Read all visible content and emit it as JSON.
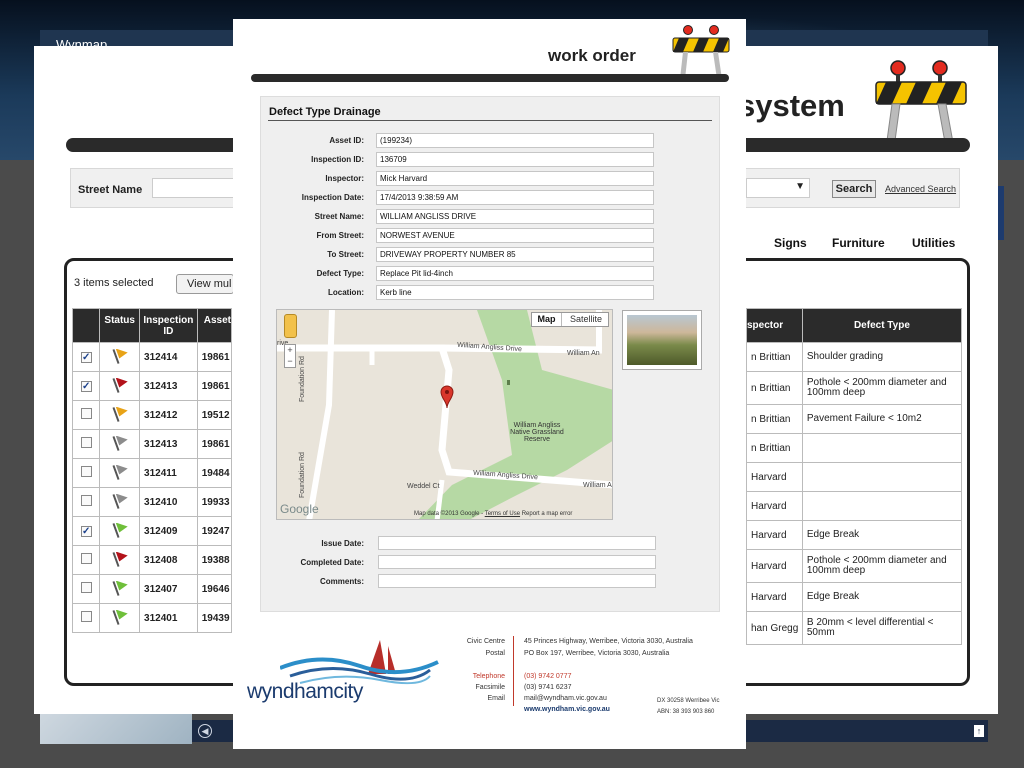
{
  "background_app": {
    "window_title": "Wynmap",
    "app_title": "system",
    "search": {
      "street_label": "Street Name",
      "search_button": "Search",
      "advanced_search": "Advanced Search"
    },
    "tabs": [
      "Signs",
      "Furniture",
      "Utilities"
    ],
    "items_selected": "3 items selected",
    "view_button": "View mul",
    "left_table": {
      "headers": [
        "Status",
        "Inspection ID",
        "Asset"
      ],
      "rows": [
        {
          "checked": true,
          "flag": "#e8a317",
          "id": "312414",
          "asset": "19861"
        },
        {
          "checked": true,
          "flag": "#b3121a",
          "id": "312413",
          "asset": "19861"
        },
        {
          "checked": false,
          "flag": "#e8a317",
          "id": "312412",
          "asset": "19512"
        },
        {
          "checked": false,
          "flag": "#8c8c8c",
          "id": "312413",
          "asset": "19861"
        },
        {
          "checked": false,
          "flag": "#8c8c8c",
          "id": "312411",
          "asset": "19484"
        },
        {
          "checked": false,
          "flag": "#8c8c8c",
          "id": "312410",
          "asset": "19933"
        },
        {
          "checked": true,
          "flag": "#6fbf3a",
          "id": "312409",
          "asset": "19247"
        },
        {
          "checked": false,
          "flag": "#b3121a",
          "id": "312408",
          "asset": "19388"
        },
        {
          "checked": false,
          "flag": "#6fbf3a",
          "id": "312407",
          "asset": "19646"
        },
        {
          "checked": false,
          "flag": "#6fbf3a",
          "id": "312401",
          "asset": "19439"
        }
      ]
    },
    "right_table": {
      "headers": [
        "spector",
        "Defect Type"
      ],
      "rows": [
        {
          "inspector": "n Brittian",
          "defect": "Shoulder grading"
        },
        {
          "inspector": "n Brittian",
          "defect": "Pothole < 200mm diameter and 100mm deep"
        },
        {
          "inspector": "n Brittian",
          "defect": "Pavement Failure < 10m2"
        },
        {
          "inspector": "n Brittian",
          "defect": ""
        },
        {
          "inspector": "Harvard",
          "defect": ""
        },
        {
          "inspector": "Harvard",
          "defect": ""
        },
        {
          "inspector": "Harvard",
          "defect": "Edge Break"
        },
        {
          "inspector": "Harvard",
          "defect": "Pothole < 200mm diameter and 100mm deep"
        },
        {
          "inspector": "Harvard",
          "defect": "Edge Break"
        },
        {
          "inspector": "han Gregg",
          "defect": "B 20mm < level differential < 50mm"
        }
      ]
    }
  },
  "work_order": {
    "title": "work order",
    "heading": "Defect Type Drainage",
    "fields": [
      {
        "label": "Asset ID:",
        "value": "(199234)"
      },
      {
        "label": "Inspection ID:",
        "value": "136709"
      },
      {
        "label": "Inspector:",
        "value": "Mick Harvard"
      },
      {
        "label": "Inspection Date:",
        "value": "17/4/2013 9:38:59 AM"
      },
      {
        "label": "Street Name:",
        "value": "WILLIAM ANGLISS DRIVE"
      },
      {
        "label": "From Street:",
        "value": "NORWEST AVENUE"
      },
      {
        "label": "To Street:",
        "value": "DRIVEWAY PROPERTY NUMBER 85"
      },
      {
        "label": "Defect Type:",
        "value": "Replace Pit lid-4inch"
      },
      {
        "label": "Location:",
        "value": "Kerb line"
      }
    ],
    "map": {
      "toggle_map": "Map",
      "toggle_satellite": "Satellite",
      "labels": {
        "street_top": "William Angliss Drive",
        "street_top_right": "William An",
        "street_bottom": "William Angliss Drive",
        "street_bottom_right": "William A",
        "foundation_top": "Foundation Rd",
        "foundation_bottom": "Foundation Rd",
        "weddel": "Weddel Ct",
        "reserve": "William Angliss Native Grassland Reserve",
        "left_drive": "rive",
        "google": "Google",
        "attribution": "Map data ©2013 Google -",
        "terms": "Terms of Use",
        "report": "Report a map error"
      }
    },
    "lower_fields": [
      {
        "label": "Issue Date:"
      },
      {
        "label": "Completed Date:"
      },
      {
        "label": "Comments:"
      }
    ],
    "footer": {
      "civic_label": "Civic Centre",
      "civic_value": "45 Princes Highway, Werribee, Victoria 3030, Australia",
      "postal_label": "Postal",
      "postal_value": "PO Box 197, Werribee, Victoria 3030, Australia",
      "telephone_label": "Telephone",
      "telephone_value": "(03) 9742 0777",
      "facsimile_label": "Facsimile",
      "facsimile_value": "(03) 9741 6237",
      "email_label": "Email",
      "email_value": "mail@wyndham.vic.gov.au",
      "website": "www.wyndham.vic.gov.au",
      "dx": "DX 30258 Werribee Vic",
      "abn": "ABN: 38 393 903 860",
      "logo": "wyndhamcity"
    }
  }
}
